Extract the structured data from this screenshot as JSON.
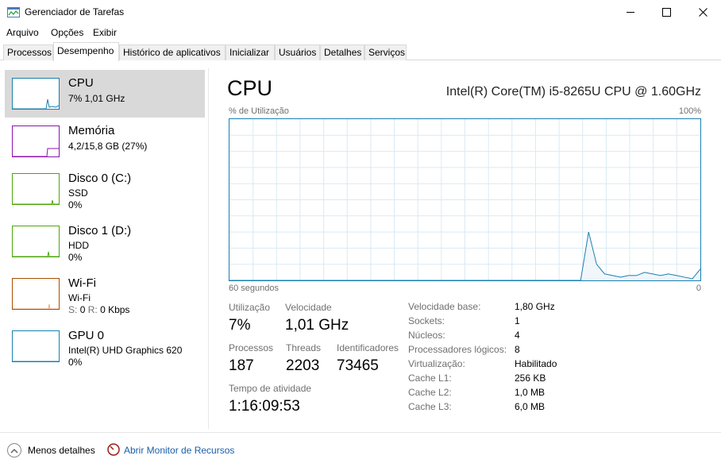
{
  "window": {
    "title": "Gerenciador de Tarefas"
  },
  "menu": [
    "Arquivo",
    "Opções",
    "Exibir"
  ],
  "tabs": [
    "Processos",
    "Desempenho",
    "Histórico de aplicativos",
    "Inicializar",
    "Usuários",
    "Detalhes",
    "Serviços"
  ],
  "active_tab": "Desempenho",
  "sidebar": [
    {
      "name": "CPU",
      "lines": [
        "7%  1,01 GHz"
      ],
      "color": "#1a7fb0"
    },
    {
      "name": "Memória",
      "lines": [
        "4,2/15,8 GB (27%)"
      ],
      "color": "#8b12ae"
    },
    {
      "name": "Disco 0 (C:)",
      "lines": [
        "SSD",
        "0%"
      ],
      "color": "#4da60c"
    },
    {
      "name": "Disco 1 (D:)",
      "lines": [
        "HDD",
        "0%"
      ],
      "color": "#4da60c"
    },
    {
      "name": "Wi-Fi",
      "lines": [
        "Wi-Fi"
      ],
      "color": "#a74f01",
      "rates": {
        "send_label": "S:",
        "send": "0",
        "recv_label": "R:",
        "recv": "0 Kbps"
      }
    },
    {
      "name": "GPU 0",
      "lines": [
        "Intel(R) UHD Graphics 620",
        "0%"
      ],
      "color": "#1a7fb0"
    }
  ],
  "main": {
    "title": "CPU",
    "model": "Intel(R) Core(TM) i5-8265U CPU @ 1.60GHz",
    "graph_label": "% de Utilização",
    "graph_max": "100%",
    "axis_left": "60 segundos",
    "axis_right": "0",
    "graph_color": "#1a7fb0",
    "graph_fill": "#f1f6fa",
    "utilization_series": [
      0,
      0,
      0,
      0,
      0,
      0,
      0,
      0,
      0,
      0,
      0,
      0,
      0,
      0,
      0,
      0,
      0,
      0,
      0,
      0,
      0,
      0,
      0,
      0,
      0,
      0,
      0,
      0,
      0,
      0,
      0,
      0,
      0,
      0,
      0,
      0,
      0,
      0,
      0,
      0,
      0,
      0,
      0,
      0,
      0,
      30,
      10,
      4,
      3,
      2,
      3,
      3,
      5,
      4,
      3,
      4,
      3,
      2,
      1,
      7
    ]
  },
  "stats": {
    "utilizacao_label": "Utilização",
    "utilizacao": "7%",
    "velocidade_label": "Velocidade",
    "velocidade": "1,01 GHz",
    "processos_label": "Processos",
    "processos": "187",
    "threads_label": "Threads",
    "threads": "2203",
    "identificadores_label": "Identificadores",
    "identificadores": "73465",
    "tempo_label": "Tempo de atividade",
    "tempo": "1:16:09:53"
  },
  "specs": [
    {
      "label": "Velocidade base:",
      "value": "1,80 GHz"
    },
    {
      "label": "Sockets:",
      "value": "1"
    },
    {
      "label": "Núcleos:",
      "value": "4"
    },
    {
      "label": "Processadores lógicos:",
      "value": "8"
    },
    {
      "label": "Virtualização:",
      "value": "Habilitado"
    },
    {
      "label": "Cache L1:",
      "value": "256 KB"
    },
    {
      "label": "Cache L2:",
      "value": "1,0 MB"
    },
    {
      "label": "Cache L3:",
      "value": "6,0 MB"
    }
  ],
  "footer": {
    "less_details": "Menos detalhes",
    "resource_monitor": "Abrir Monitor de Recursos"
  }
}
